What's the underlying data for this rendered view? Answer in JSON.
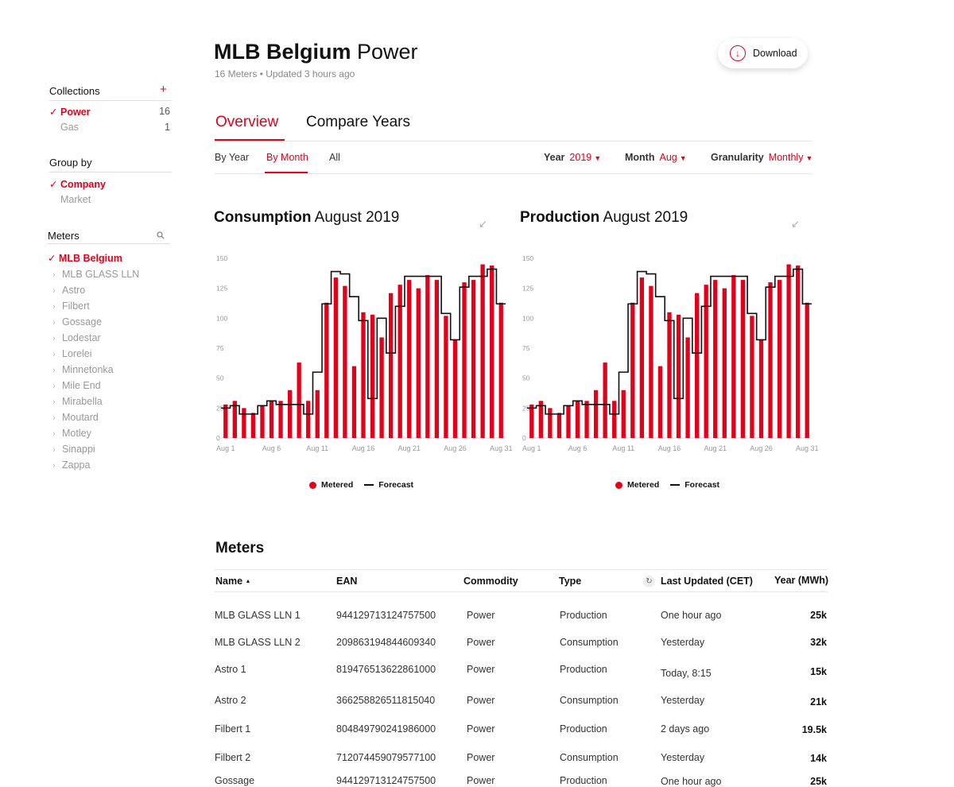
{
  "sidebar": {
    "collections": {
      "title": "Collections",
      "add": "+",
      "items": [
        {
          "label": "Power",
          "count": "16",
          "active": true
        },
        {
          "label": "Gas",
          "count": "1",
          "active": false
        }
      ]
    },
    "group_by": {
      "title": "Group by",
      "items": [
        {
          "label": "Company",
          "active": true
        },
        {
          "label": "Market",
          "active": false
        }
      ]
    },
    "meters": {
      "title": "Meters",
      "search_icon": "search-icon",
      "items": [
        {
          "label": "MLB Belgium",
          "active": true
        },
        {
          "label": "MLB GLASS LLN"
        },
        {
          "label": "Astro"
        },
        {
          "label": "Filbert"
        },
        {
          "label": "Gossage"
        },
        {
          "label": "Lodestar"
        },
        {
          "label": "Lorelei"
        },
        {
          "label": "Minnetonka"
        },
        {
          "label": "Mile End"
        },
        {
          "label": "Mirabella"
        },
        {
          "label": "Moutard"
        },
        {
          "label": "Motley"
        },
        {
          "label": "Sinappi"
        },
        {
          "label": "Zappa"
        }
      ]
    }
  },
  "header": {
    "title_bold": "MLB Belgium",
    "title_light": "Power",
    "subtitle": "16 Meters • Updated 3 hours ago",
    "download_label": "Download",
    "download_icon": "download-arrow-icon"
  },
  "tabs": [
    {
      "label": "Overview",
      "active": true
    },
    {
      "label": "Compare Years",
      "active": false
    }
  ],
  "subtabs": [
    {
      "label": "By Year",
      "active": false
    },
    {
      "label": "By Month",
      "active": true
    },
    {
      "label": "All",
      "active": false
    }
  ],
  "filters": [
    {
      "label": "Year",
      "value": "2019"
    },
    {
      "label": "Month",
      "value": "Aug"
    },
    {
      "label": "Granularity",
      "value": "Monthly"
    }
  ],
  "colors": {
    "accent": "#e3001b",
    "text": "#111111",
    "muted": "#999999"
  },
  "charts": [
    {
      "title_bold": "Consumption",
      "title_light": "August 2019"
    },
    {
      "title_bold": "Production",
      "title_light": "August 2019"
    }
  ],
  "chart_data": [
    {
      "type": "bar",
      "x": [
        "Aug 1",
        "Aug 2",
        "Aug 3",
        "Aug 4",
        "Aug 5",
        "Aug 6",
        "Aug 7",
        "Aug 8",
        "Aug 9",
        "Aug 10",
        "Aug 11",
        "Aug 12",
        "Aug 13",
        "Aug 14",
        "Aug 15",
        "Aug 16",
        "Aug 17",
        "Aug 18",
        "Aug 19",
        "Aug 20",
        "Aug 21",
        "Aug 22",
        "Aug 23",
        "Aug 24",
        "Aug 25",
        "Aug 26",
        "Aug 27",
        "Aug 28",
        "Aug 29",
        "Aug 30",
        "Aug 31"
      ],
      "x_ticks": [
        "Aug 1",
        "Aug 6",
        "Aug 11",
        "Aug 16",
        "Aug 21",
        "Aug 26",
        "Aug 31"
      ],
      "y_ticks": [
        0,
        25,
        50,
        75,
        100,
        125,
        150
      ],
      "ylim": [
        0,
        150
      ],
      "series": [
        {
          "name": "Metered",
          "style": "bar",
          "color": "#e3001b",
          "values": [
            28,
            31,
            25,
            21,
            27,
            31,
            31,
            40,
            63,
            31,
            40,
            113,
            134,
            127,
            60,
            105,
            103,
            84,
            121,
            128,
            132,
            125,
            136,
            132,
            102,
            82,
            130,
            132,
            145,
            144,
            113
          ]
        },
        {
          "name": "Forecast",
          "style": "step",
          "color": "#111111",
          "values": [
            25,
            27,
            20,
            20,
            27,
            31,
            28,
            28,
            28,
            20,
            55,
            112,
            139,
            137,
            118,
            98,
            33,
            100,
            71,
            110,
            135,
            135,
            135,
            135,
            104,
            82,
            126,
            135,
            135,
            141,
            112
          ]
        }
      ]
    },
    {
      "type": "bar",
      "x": [
        "Aug 1",
        "Aug 2",
        "Aug 3",
        "Aug 4",
        "Aug 5",
        "Aug 6",
        "Aug 7",
        "Aug 8",
        "Aug 9",
        "Aug 10",
        "Aug 11",
        "Aug 12",
        "Aug 13",
        "Aug 14",
        "Aug 15",
        "Aug 16",
        "Aug 17",
        "Aug 18",
        "Aug 19",
        "Aug 20",
        "Aug 21",
        "Aug 22",
        "Aug 23",
        "Aug 24",
        "Aug 25",
        "Aug 26",
        "Aug 27",
        "Aug 28",
        "Aug 29",
        "Aug 30",
        "Aug 31"
      ],
      "x_ticks": [
        "Aug 1",
        "Aug 6",
        "Aug 11",
        "Aug 16",
        "Aug 21",
        "Aug 26",
        "Aug 31"
      ],
      "y_ticks": [
        0,
        25,
        50,
        75,
        100,
        125,
        150
      ],
      "ylim": [
        0,
        150
      ],
      "series": [
        {
          "name": "Metered",
          "style": "bar",
          "color": "#e3001b",
          "values": [
            28,
            31,
            25,
            21,
            27,
            31,
            31,
            40,
            63,
            31,
            40,
            113,
            134,
            127,
            60,
            105,
            103,
            84,
            121,
            128,
            132,
            125,
            136,
            132,
            102,
            82,
            130,
            132,
            145,
            144,
            113
          ]
        },
        {
          "name": "Forecast",
          "style": "step",
          "color": "#111111",
          "values": [
            25,
            27,
            20,
            20,
            27,
            31,
            28,
            28,
            28,
            20,
            55,
            112,
            139,
            137,
            118,
            98,
            33,
            100,
            71,
            110,
            135,
            135,
            135,
            135,
            104,
            82,
            126,
            135,
            135,
            141,
            112
          ]
        }
      ]
    }
  ],
  "legend": {
    "metered": "Metered",
    "forecast": "Forecast"
  },
  "table": {
    "title": "Meters",
    "columns": [
      "Name",
      "EAN",
      "Commodity",
      "Type",
      "Last Updated (CET)",
      "Year (MWh)"
    ],
    "sort_indicator": "▲",
    "rows": [
      {
        "name": "MLB GLASS LLN 1",
        "ean": "944129713124757500",
        "commodity": "Power",
        "type": "Production",
        "updated": "One hour ago",
        "year": "25k"
      },
      {
        "name": "MLB GLASS LLN 2",
        "ean": "209863194844609340",
        "commodity": "Power",
        "type": "Consumption",
        "updated": "Yesterday",
        "year": "32k"
      },
      {
        "name": "Astro 1",
        "ean": "819476513622861000",
        "commodity": "Power",
        "type": "Production",
        "updated": "Today, 8:15",
        "year": "15k"
      },
      {
        "name": "Astro 2",
        "ean": "366258826511815040",
        "commodity": "Power",
        "type": "Consumption",
        "updated": "Yesterday",
        "year": "21k"
      },
      {
        "name": "Filbert 1",
        "ean": "804849790241986000",
        "commodity": "Power",
        "type": "Production",
        "updated": "2 days ago",
        "year": "19.5k"
      },
      {
        "name": "Filbert 2",
        "ean": "712074459079577100",
        "commodity": "Power",
        "type": "Consumption",
        "updated": "Yesterday",
        "year": "14k"
      },
      {
        "name": "Gossage",
        "ean": "944129713124757500",
        "commodity": "Power",
        "type": "Production",
        "updated": "One hour ago",
        "year": "25k"
      }
    ]
  }
}
